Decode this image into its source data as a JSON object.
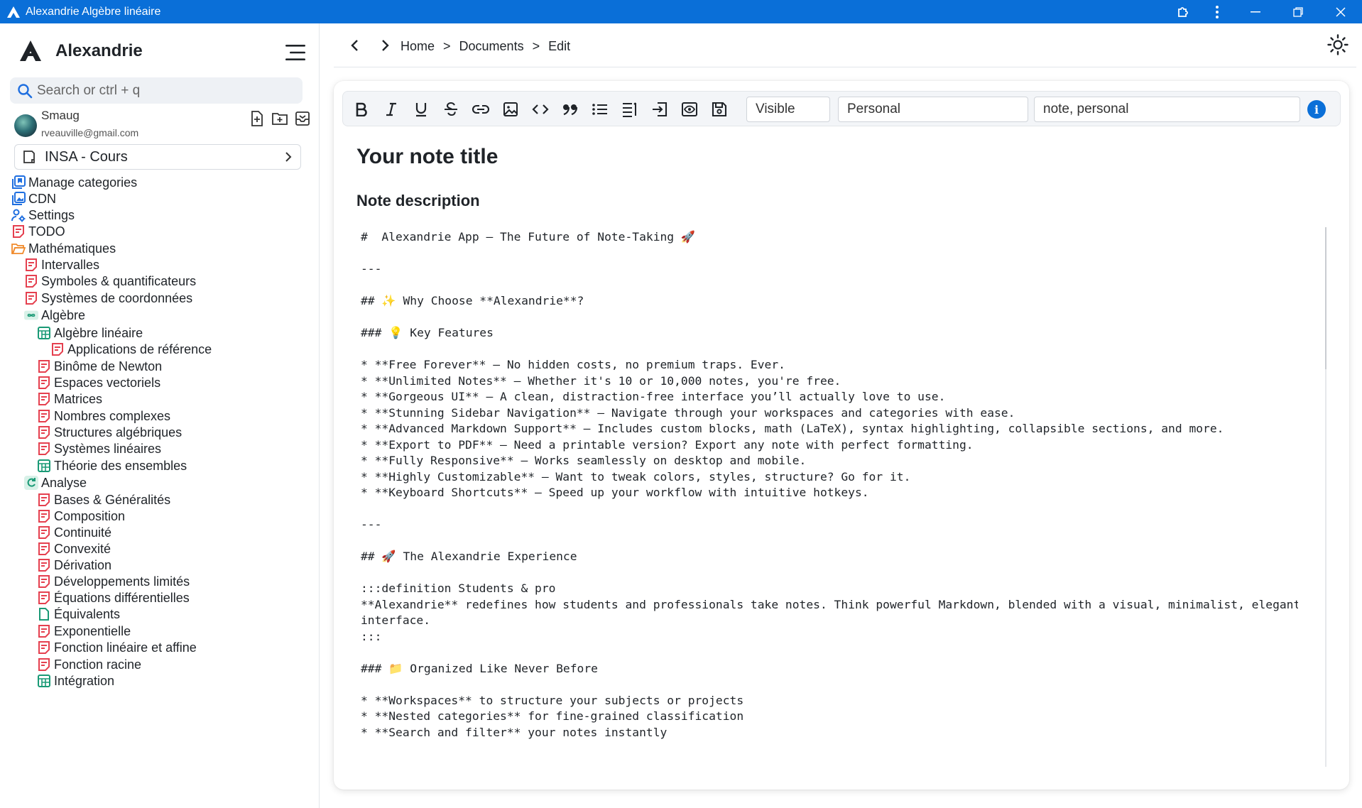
{
  "window": {
    "title": "Alexandrie Algèbre linéaire"
  },
  "sidebar": {
    "brand": "Alexandrie",
    "search_placeholder": "Search or ctrl + q",
    "user": {
      "name": "Smaug",
      "email": "rveauville@gmail.com"
    },
    "workspace": "INSA - Cours",
    "items": [
      {
        "label": "Manage categories",
        "icon": "categories-icon",
        "depth": 0
      },
      {
        "label": "CDN",
        "icon": "cdn-icon",
        "depth": 0
      },
      {
        "label": "Settings",
        "icon": "settings-users-icon",
        "depth": 0
      },
      {
        "label": "TODO",
        "icon": "note-icon",
        "depth": 0
      },
      {
        "label": "Mathématiques",
        "icon": "folder-open-icon",
        "depth": 0
      },
      {
        "label": "Intervalles",
        "icon": "note-icon",
        "depth": 1
      },
      {
        "label": "Symboles & quantificateurs",
        "icon": "note-icon",
        "depth": 1
      },
      {
        "label": "Systèmes de coordonnées",
        "icon": "note-icon",
        "depth": 1
      },
      {
        "label": "Algèbre",
        "icon": "infinity-icon",
        "depth": 1
      },
      {
        "label": "Algèbre linéaire",
        "icon": "matrix-icon",
        "depth": 2
      },
      {
        "label": "Applications de référence",
        "icon": "note-icon",
        "depth": 3
      },
      {
        "label": "Binôme de Newton",
        "icon": "note-icon",
        "depth": 2
      },
      {
        "label": "Espaces vectoriels",
        "icon": "note-icon",
        "depth": 2
      },
      {
        "label": "Matrices",
        "icon": "note-icon",
        "depth": 2
      },
      {
        "label": "Nombres complexes",
        "icon": "note-icon",
        "depth": 2
      },
      {
        "label": "Structures algébriques",
        "icon": "note-icon",
        "depth": 2
      },
      {
        "label": "Systèmes linéaires",
        "icon": "note-icon",
        "depth": 2
      },
      {
        "label": "Théorie des ensembles",
        "icon": "matrix-icon",
        "depth": 2
      },
      {
        "label": "Analyse",
        "icon": "analysis-icon",
        "depth": 1
      },
      {
        "label": "Bases & Généralités",
        "icon": "note-icon",
        "depth": 2
      },
      {
        "label": "Composition",
        "icon": "note-icon",
        "depth": 2
      },
      {
        "label": "Continuité",
        "icon": "note-icon",
        "depth": 2
      },
      {
        "label": "Convexité",
        "icon": "note-icon",
        "depth": 2
      },
      {
        "label": "Dérivation",
        "icon": "note-icon",
        "depth": 2
      },
      {
        "label": "Développements limités",
        "icon": "note-icon",
        "depth": 2
      },
      {
        "label": "Équations différentielles",
        "icon": "note-icon",
        "depth": 2
      },
      {
        "label": "Équivalents",
        "icon": "file-icon",
        "depth": 2
      },
      {
        "label": "Exponentielle",
        "icon": "note-icon",
        "depth": 2
      },
      {
        "label": "Fonction linéaire et affine",
        "icon": "note-icon",
        "depth": 2
      },
      {
        "label": "Fonction racine",
        "icon": "note-icon",
        "depth": 2
      },
      {
        "label": "Intégration",
        "icon": "matrix-icon",
        "depth": 2
      }
    ]
  },
  "breadcrumb": {
    "home": "Home",
    "documents": "Documents",
    "edit": "Edit",
    "separator": ">"
  },
  "toolbar": {
    "visibility": "Visible",
    "category": "Personal",
    "tags": "note, personal"
  },
  "note": {
    "title_placeholder": "Your note title",
    "description_placeholder": "Note description",
    "lines": [
      "#  Alexandrie App – The Future of Note-Taking 🚀",
      "",
      "---",
      "",
      "## ✨ Why Choose **Alexandrie**?",
      "",
      "### 💡 Key Features",
      "",
      "* **Free Forever** – No hidden costs, no premium traps. Ever.",
      "* **Unlimited Notes** – Whether it's 10 or 10,000 notes, you're free.",
      "* **Gorgeous UI** – A clean, distraction-free interface you’ll actually love to use.",
      "* **Stunning Sidebar Navigation** – Navigate through your workspaces and categories with ease.",
      "* **Advanced Markdown Support** – Includes custom blocks, math (LaTeX), syntax highlighting, collapsible sections, and more.",
      "* **Export to PDF** – Need a printable version? Export any note with perfect formatting.",
      "* **Fully Responsive** – Works seamlessly on desktop and mobile.",
      "* **Highly Customizable** – Want to tweak colors, styles, structure? Go for it.",
      "* **Keyboard Shortcuts** – Speed up your workflow with intuitive hotkeys.",
      "",
      "---",
      "",
      "## 🚀 The Alexandrie Experience",
      "",
      ":::definition Students & pro",
      "**Alexandrie** redefines how students and professionals take notes. Think powerful Markdown, blended with a visual, minimalist, elegant",
      "interface.",
      ":::",
      "",
      "### 📁 Organized Like Never Before",
      "",
      "* **Workspaces** to structure your subjects or projects",
      "* **Nested categories** for fine-grained classification",
      "* **Search and filter** your notes instantly"
    ]
  },
  "colors": {
    "titlebar": "#0a6fd8",
    "note_icon": "#e5404f",
    "structure_icon": "#1a9a76",
    "link_icon": "#1f6fe0",
    "folder_icon": "#f08a2b"
  }
}
